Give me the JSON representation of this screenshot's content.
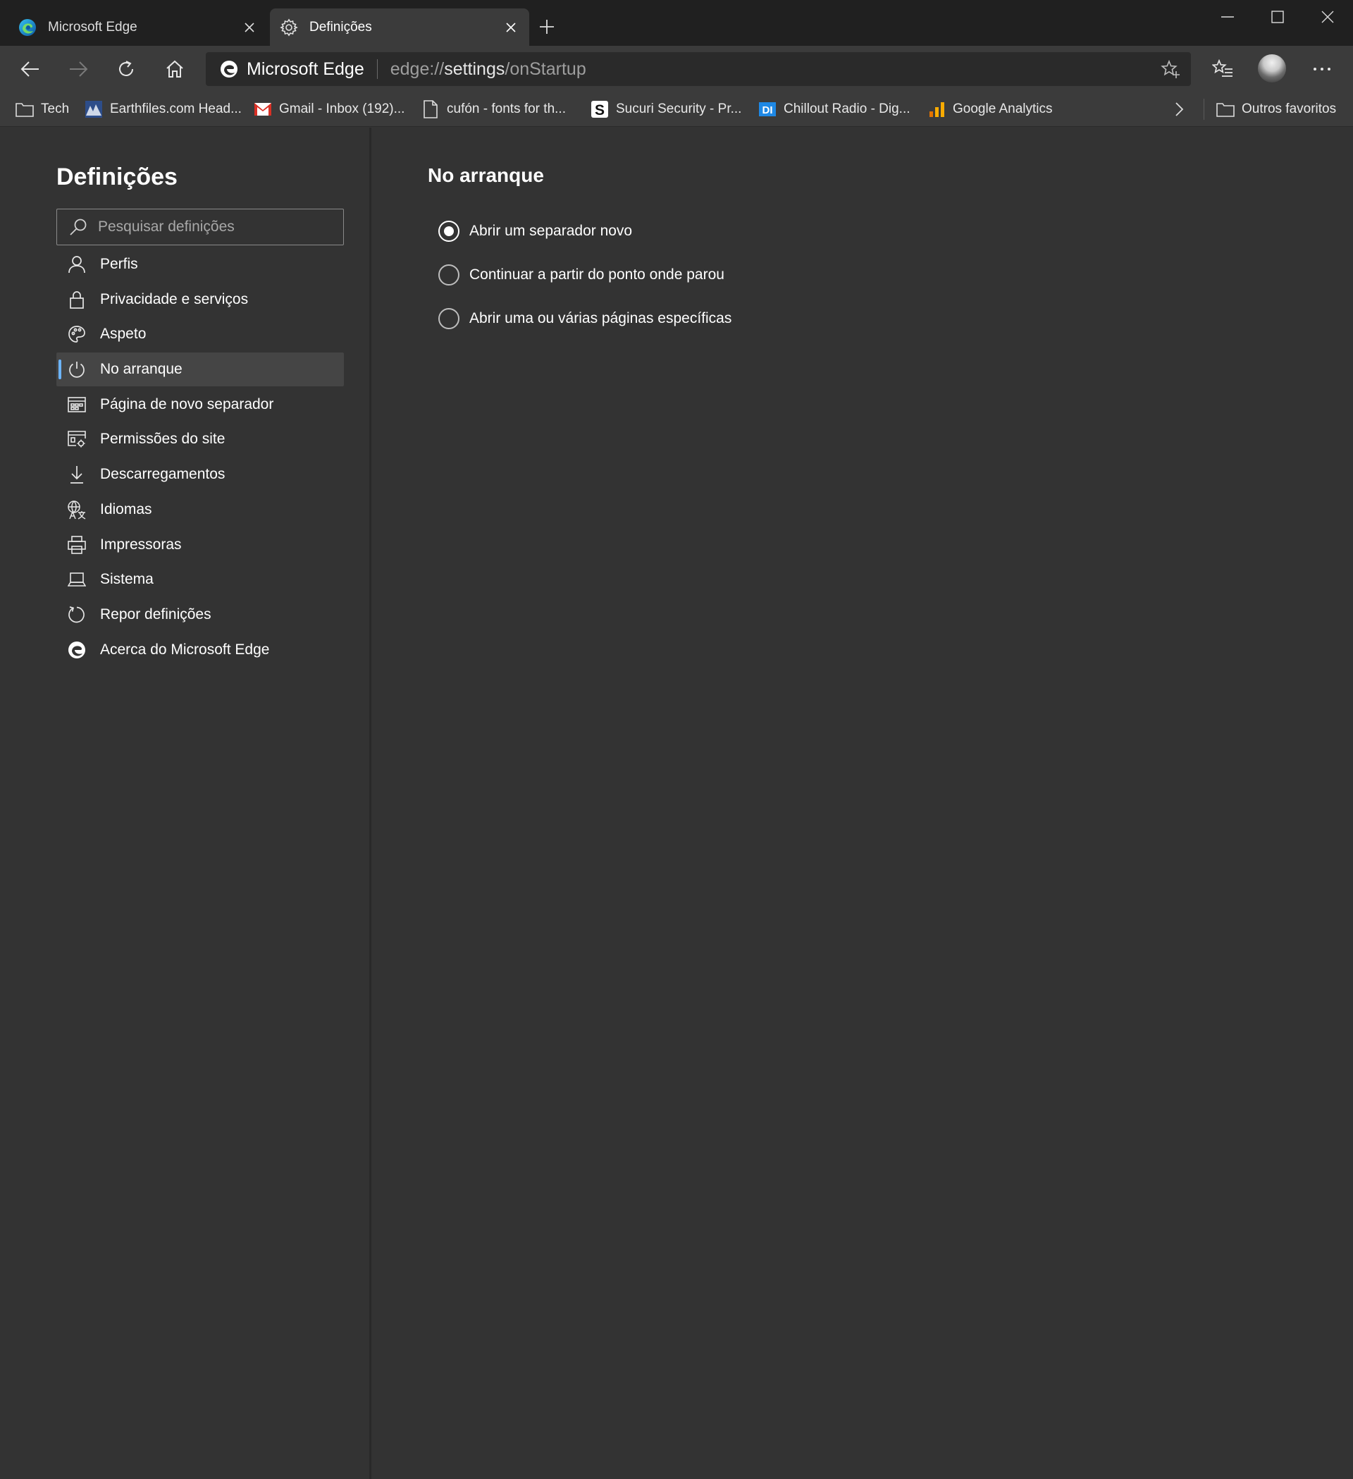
{
  "tabs": [
    {
      "title": "Microsoft Edge",
      "icon": "edge-logo-icon",
      "active": false
    },
    {
      "title": "Definições",
      "icon": "gear-icon",
      "active": true
    }
  ],
  "toolbar": {
    "site_name": "Microsoft Edge",
    "url_prefix": "edge://",
    "url_highlight": "settings",
    "url_suffix": "/onStartup"
  },
  "bookmarks": [
    {
      "label": "Tech",
      "icon": "folder-icon"
    },
    {
      "label": "Earthfiles.com Head...",
      "icon": "earthfiles-favicon-icon"
    },
    {
      "label": "Gmail - Inbox (192)...",
      "icon": "gmail-icon"
    },
    {
      "label": "cufón - fonts for th...",
      "icon": "page-icon"
    },
    {
      "label": "Sucuri Security - Pr...",
      "icon": "sucuri-icon"
    },
    {
      "label": "Chillout Radio - Dig...",
      "icon": "di-radio-icon"
    },
    {
      "label": "Google Analytics",
      "icon": "analytics-icon"
    }
  ],
  "bookmarks_other": "Outros favoritos",
  "sidebar": {
    "title": "Definições",
    "search_placeholder": "Pesquisar definições",
    "items": [
      {
        "label": "Perfis",
        "icon": "person-icon"
      },
      {
        "label": "Privacidade e serviços",
        "icon": "lock-icon"
      },
      {
        "label": "Aspeto",
        "icon": "palette-icon"
      },
      {
        "label": "No arranque",
        "icon": "power-icon",
        "selected": true
      },
      {
        "label": "Página de novo separador",
        "icon": "new-tab-page-icon"
      },
      {
        "label": "Permissões do site",
        "icon": "site-permissions-icon"
      },
      {
        "label": "Descarregamentos",
        "icon": "download-icon"
      },
      {
        "label": "Idiomas",
        "icon": "languages-icon"
      },
      {
        "label": "Impressoras",
        "icon": "printer-icon"
      },
      {
        "label": "Sistema",
        "icon": "laptop-icon"
      },
      {
        "label": "Repor definições",
        "icon": "reset-icon"
      },
      {
        "label": "Acerca do Microsoft Edge",
        "icon": "edge-logo-icon"
      }
    ]
  },
  "main": {
    "section_title": "No arranque",
    "options": [
      {
        "label": "Abrir um separador novo",
        "checked": true
      },
      {
        "label": "Continuar a partir do ponto onde parou",
        "checked": false
      },
      {
        "label": "Abrir uma ou várias páginas específicas",
        "checked": false
      }
    ]
  },
  "colors": {
    "accent": "#6cb4ff",
    "background": "#333333",
    "titlebar": "#202020",
    "toolbar": "#3b3b3b"
  }
}
